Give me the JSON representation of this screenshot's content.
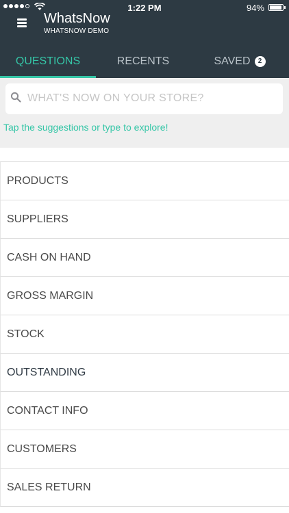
{
  "status_bar": {
    "time": "1:22 PM",
    "battery_percent": "94%",
    "battery_level": 0.94,
    "signal_bars_filled": 4
  },
  "header": {
    "title": "WhatsNow",
    "subtitle": "WHATSNOW DEMO",
    "menu_icon": "hamburger-menu-icon"
  },
  "tabs": [
    {
      "label": "QUESTIONS",
      "active": true
    },
    {
      "label": "RECENTS",
      "active": false
    },
    {
      "label": "SAVED",
      "active": false,
      "badge": "2"
    }
  ],
  "search": {
    "placeholder": "WHAT'S NOW ON YOUR STORE?",
    "value": "",
    "icon": "search-icon"
  },
  "hint": "Tap the suggestions or type to explore!",
  "suggestions": [
    "PRODUCTS",
    "SUPPLIERS",
    "CASH ON HAND",
    "GROSS MARGIN",
    "STOCK",
    "OUTSTANDING",
    "CONTACT INFO",
    "CUSTOMERS",
    "SALES RETURN"
  ],
  "colors": {
    "header_bg": "#2d3a43",
    "accent": "#35c6a7",
    "inactive_tab": "#b9c2c8",
    "search_area_bg": "#efefef"
  }
}
